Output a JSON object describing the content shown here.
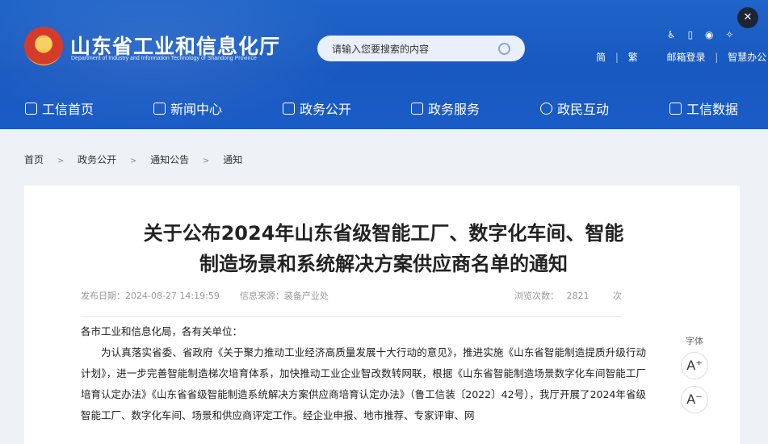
{
  "header": {
    "site_name": "山东省工业和信息化厅",
    "site_name_en": "Department of Industry and Information Technology of Shandong Province",
    "search_placeholder": "请输入您要搜索的内容",
    "tools": [
      "♿",
      "▯",
      "◉",
      "✧"
    ],
    "links": {
      "simplified": "简",
      "traditional": "繁",
      "email": "邮箱登录",
      "smart_office": "智慧办公"
    }
  },
  "nav": {
    "items": [
      {
        "label": "工信首页",
        "icon": "home-icon"
      },
      {
        "label": "新闻中心",
        "icon": "news-icon"
      },
      {
        "label": "政务公开",
        "icon": "monitor-icon"
      },
      {
        "label": "政务服务",
        "icon": "service-icon"
      },
      {
        "label": "政民互动",
        "icon": "chat-icon"
      },
      {
        "label": "工信数据",
        "icon": "database-icon"
      }
    ]
  },
  "breadcrumb": [
    "首页",
    "政务公开",
    "通知公告",
    "通知"
  ],
  "article": {
    "title_line1": "关于公布2024年山东省级智能工厂、数字化车间、智能",
    "title_line2": "制造场景和系统解决方案供应商名单的通知",
    "publish_label": "发布日期：",
    "publish_date": "2024-08-27 14:19:59",
    "source_label": "信息来源：",
    "source": "装备产业处",
    "views_label": "浏览次数：",
    "views_count": "2821",
    "views_unit": "次",
    "greeting": "各市工业和信息化局，各有关单位：",
    "paragraph": "为认真落实省委、省政府《关于聚力推动工业经济高质量发展十大行动的意见》，推进实施《山东省智能制造提质升级行动计划》，进一步完善智能制造梯次培育体系，加快推动工业企业智改数转网联，根据《山东省智能制造场景数字化车间智能工厂培育认定办法》《山东省省级智能制造系统解决方案供应商培育认定办法》（鲁工信装〔2022〕42号），我厅开展了2024年省级智能工厂、数字化车间、场景和供应商评定工作。经企业申报、地市推荐、专家评审、网"
  },
  "font_tool": {
    "label": "字体",
    "increase": "A⁺",
    "decrease": "A⁻"
  },
  "overlay": {
    "close": "✕"
  }
}
